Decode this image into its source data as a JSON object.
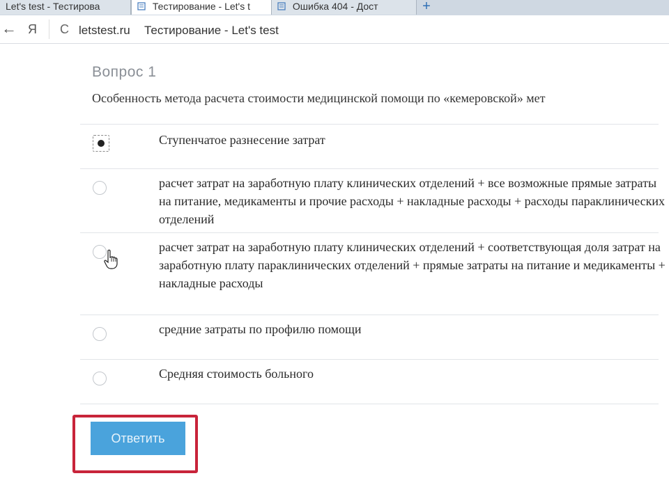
{
  "browser": {
    "tabs": [
      {
        "label": "Let's test - Тестирова"
      },
      {
        "label": "Тестирование - Let's t"
      },
      {
        "label": "Ошибка 404 - Дост"
      }
    ],
    "new_tab": "+",
    "back": "←",
    "yandex": "Я",
    "reload": "C",
    "domain": "letstest.ru",
    "page_title": "Тестирование - Let's test"
  },
  "question": {
    "number": "Вопрос 1",
    "text": "Особенность метода расчета стоимости медицинской помощи по «кемеровской» мет"
  },
  "options": [
    {
      "text": "Ступенчатое разнесение затрат",
      "selected": true
    },
    {
      "text": "расчет затрат на заработную плату клинических отделений + все возможные прямые затраты на питание, медикаменты и прочие расходы + накладные расходы + расходы параклинических отделений",
      "selected": false
    },
    {
      "text": "расчет затрат на заработную плату клинических отделений + соответствующая доля затрат на заработную плату параклинических отделений + прямые затраты на питание и медикаменты + накладные расходы",
      "selected": false
    },
    {
      "text": "средние затраты по профилю помощи",
      "selected": false
    },
    {
      "text": "Средняя стоимость больного",
      "selected": false
    }
  ],
  "submit": {
    "label": "Ответить"
  },
  "colors": {
    "submit_button": "#4aa3dc",
    "highlight_frame": "#c8243a"
  }
}
